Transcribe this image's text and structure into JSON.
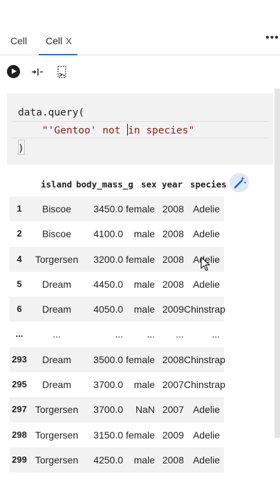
{
  "tabs": [
    {
      "label": "Cell",
      "active": false
    },
    {
      "label": "Cell",
      "active": true,
      "close": "X"
    }
  ],
  "more_label": "•••",
  "toolbar": {
    "run_icon": "play-circle-icon",
    "merge_icon": "merge-cells-icon",
    "split_icon": "split-cell-icon"
  },
  "code": {
    "line1": "data.query(",
    "line2_indent": "    ",
    "line2_pre": "\"'Gentoo' not ",
    "line2_post": "in species\"",
    "line3": ")"
  },
  "table": {
    "columns": [
      "",
      "island",
      "body_mass_g",
      "sex",
      "year",
      "species"
    ],
    "rows": [
      {
        "index": "1",
        "island": "Biscoe",
        "body_mass_g": "3450.0",
        "sex": "female",
        "year": "2008",
        "species": "Adelie"
      },
      {
        "index": "2",
        "island": "Biscoe",
        "body_mass_g": "4100.0",
        "sex": "male",
        "year": "2008",
        "species": "Adelie"
      },
      {
        "index": "4",
        "island": "Torgersen",
        "body_mass_g": "3200.0",
        "sex": "female",
        "year": "2008",
        "species": "Adelie"
      },
      {
        "index": "5",
        "island": "Dream",
        "body_mass_g": "4450.0",
        "sex": "male",
        "year": "2008",
        "species": "Adelie"
      },
      {
        "index": "6",
        "island": "Dream",
        "body_mass_g": "4050.0",
        "sex": "male",
        "year": "2009",
        "species": "Chinstrap"
      },
      {
        "index": "...",
        "island": "...",
        "body_mass_g": "...",
        "sex": "...",
        "year": "...",
        "species": "..."
      },
      {
        "index": "293",
        "island": "Dream",
        "body_mass_g": "3500.0",
        "sex": "female",
        "year": "2008",
        "species": "Chinstrap"
      },
      {
        "index": "295",
        "island": "Dream",
        "body_mass_g": "3700.0",
        "sex": "male",
        "year": "2007",
        "species": "Chinstrap"
      },
      {
        "index": "297",
        "island": "Torgersen",
        "body_mass_g": "3700.0",
        "sex": "NaN",
        "year": "2007",
        "species": "Adelie"
      },
      {
        "index": "298",
        "island": "Torgersen",
        "body_mass_g": "3150.0",
        "sex": "female",
        "year": "2009",
        "species": "Adelie"
      },
      {
        "index": "299",
        "island": "Torgersen",
        "body_mass_g": "4250.0",
        "sex": "male",
        "year": "2008",
        "species": "Adelie"
      }
    ]
  },
  "magic_icon": "magic-wand-icon",
  "colors": {
    "accent": "#1a73e8",
    "string": "#a31515",
    "cell_bg": "#f2f2f2"
  }
}
